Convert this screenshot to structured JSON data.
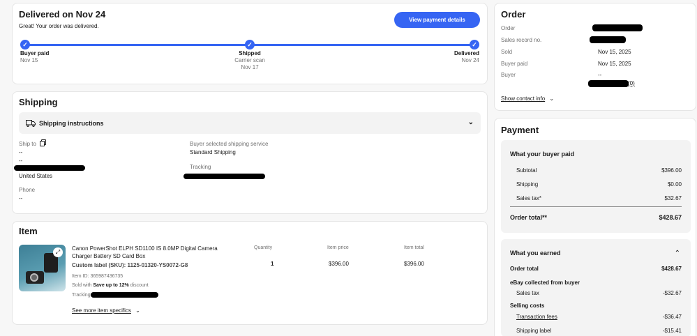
{
  "status": {
    "title": "Delivered on Nov 24",
    "subtitle": "Great! Your order was delivered.",
    "pay_button": "View payment details",
    "steps": [
      {
        "label": "Buyer paid",
        "line1": "Nov 15",
        "line2": ""
      },
      {
        "label": "Shipped",
        "line1": "Carrier scan",
        "line2": "Nov 17"
      },
      {
        "label": "Delivered",
        "line1": "Nov 24",
        "line2": ""
      }
    ]
  },
  "shipping": {
    "title": "Shipping",
    "instructions": "Shipping instructions",
    "ship_to_label": "Ship to",
    "ship_line1": "--",
    "ship_line2": "--",
    "country": "United States",
    "phone_label": "Phone",
    "phone_value": "--",
    "service_label": "Buyer selected shipping service",
    "service_value": "Standard Shipping",
    "tracking_label": "Tracking"
  },
  "item": {
    "title": "Item",
    "name": "Canon PowerShot ELPH SD1100 IS 8.0MP Digital Camera Charger Battery SD Card Box",
    "sku": "Custom label (SKU): 1125-01320-YS0072-G8",
    "item_id": "Item ID: 365987436735",
    "sold_with_prefix": "Sold with ",
    "sold_with_bold": "Save up to 12%",
    "sold_with_suffix": " discount",
    "tracking_label": "Tracking",
    "see_more": "See more item specifics",
    "quantity_label": "Quantity",
    "quantity_value": "1",
    "price_label": "Item price",
    "price_value": "$396.00",
    "total_label": "Item total",
    "total_value": "$396.00"
  },
  "order": {
    "title": "Order",
    "rows": [
      {
        "label": "Order",
        "value": ""
      },
      {
        "label": "Sales record no.",
        "value": ""
      },
      {
        "label": "Sold",
        "value": "Nov 15, 2025"
      },
      {
        "label": "Buyer paid",
        "value": "Nov 15, 2025"
      },
      {
        "label": "Buyer",
        "value": "--"
      }
    ],
    "feedback": "(0)",
    "contact_link": "Show contact info"
  },
  "payment": {
    "title": "Payment",
    "buyer_paid_title": "What your buyer paid",
    "subtotal_label": "Subtotal",
    "subtotal_value": "$396.00",
    "shipping_label": "Shipping",
    "shipping_value": "$0.00",
    "tax_label": "Sales tax*",
    "tax_value": "$32.67",
    "order_total_label": "Order total**",
    "order_total_value": "$428.67",
    "earned_title": "What you earned",
    "earned_order_total_label": "Order total",
    "earned_order_total_value": "$428.67",
    "collected_label": "eBay collected from buyer",
    "collected_tax_label": "Sales tax",
    "collected_tax_value": "-$32.67",
    "selling_costs_label": "Selling costs",
    "fees_label": "Transaction fees",
    "fees_value": "-$36.47",
    "ship_label_label": "Shipping label",
    "ship_label_value": "-$15.41"
  },
  "colors": {
    "accent": "#3665f3",
    "text": "#191919",
    "muted": "#707070",
    "panel": "#f3f3f3"
  }
}
